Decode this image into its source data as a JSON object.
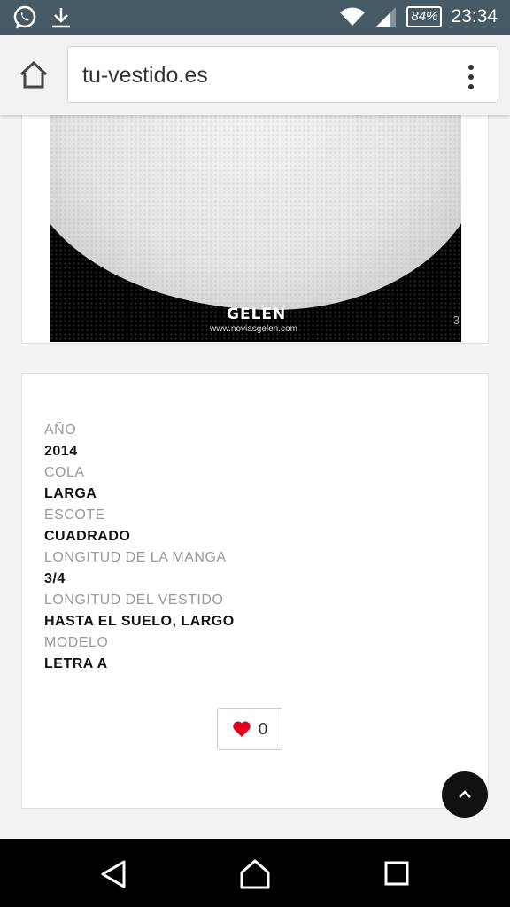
{
  "status_bar": {
    "left_icons": [
      "whatsapp-icon",
      "download-icon"
    ],
    "battery": "84%",
    "time": "23:34"
  },
  "browser": {
    "url": "tu-vestido.es"
  },
  "product_image": {
    "brand": "GELEN",
    "brand_url": "www.noviasgelen.com",
    "index": "3"
  },
  "specs": [
    {
      "label": "AÑO",
      "value": "2014"
    },
    {
      "label": "COLA",
      "value": "LARGA"
    },
    {
      "label": "ESCOTE",
      "value": "CUADRADO"
    },
    {
      "label": "LONGITUD DE LA MANGA",
      "value": "3/4"
    },
    {
      "label": "LONGITUD DEL VESTIDO",
      "value": "HASTA EL SUELO, LARGO"
    },
    {
      "label": "MODELO",
      "value": "LETRA A"
    }
  ],
  "like": {
    "count": "0",
    "icon": "heart-icon",
    "color": "#e0001b"
  },
  "colors": {
    "status_bar": "#455a64",
    "page_bg": "#f3f3f3",
    "nav_bar": "#000000"
  }
}
